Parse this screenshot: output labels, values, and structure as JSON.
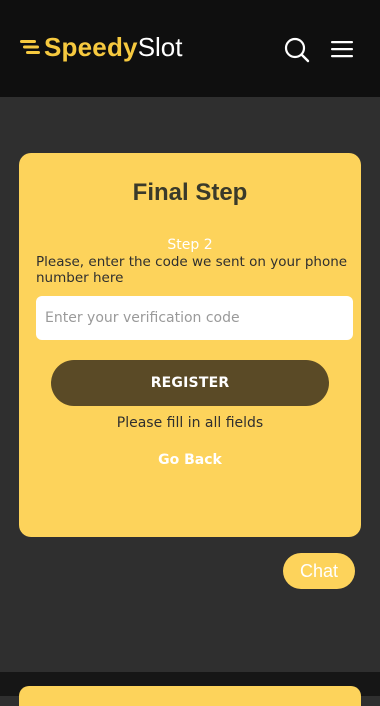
{
  "header": {
    "logo_bold": "Speedy",
    "logo_light": "Slot",
    "search_icon": "search-icon",
    "menu_icon": "hamburger-menu-icon"
  },
  "form": {
    "title": "Final Step",
    "step": "Step 2",
    "instruction": "Please, enter the code we sent on your phone number here",
    "code_placeholder": "Enter your verification code",
    "register_label": "REGISTER",
    "validation_message": "Please fill in all fields",
    "go_back_label": "Go Back"
  },
  "chat": {
    "label": "Chat"
  },
  "colors": {
    "header_bg": "#0f0f0f",
    "page_bg": "#2f2f2f",
    "accent": "#fdd35b",
    "button_dark": "#5a4a26",
    "logo_yellow": "#f6c93f"
  }
}
